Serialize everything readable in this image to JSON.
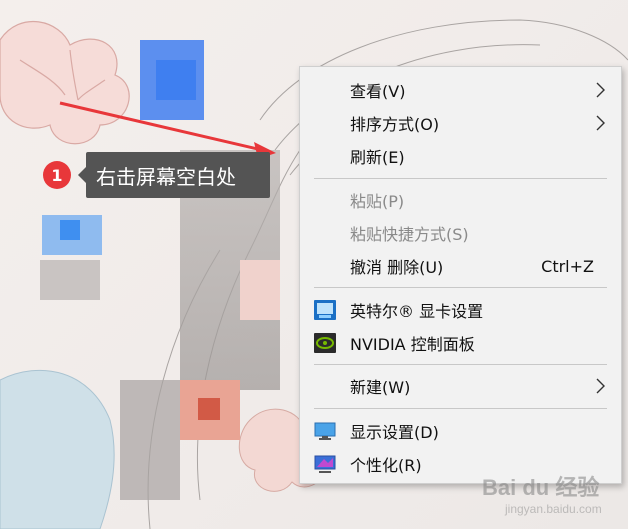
{
  "annotation": {
    "step_number": "1",
    "text": "右击屏幕空白处"
  },
  "context_menu": {
    "items": [
      {
        "label": "查看(V)",
        "has_submenu": true,
        "enabled": true
      },
      {
        "label": "排序方式(O)",
        "has_submenu": true,
        "enabled": true
      },
      {
        "label": "刷新(E)",
        "has_submenu": false,
        "enabled": true
      },
      {
        "label": "粘贴(P)",
        "has_submenu": false,
        "enabled": false
      },
      {
        "label": "粘贴快捷方式(S)",
        "has_submenu": false,
        "enabled": false
      },
      {
        "label": "撤消 删除(U)",
        "shortcut": "Ctrl+Z",
        "has_submenu": false,
        "enabled": true
      },
      {
        "label": "英特尔® 显卡设置",
        "icon": "intel-graphics-icon",
        "enabled": true
      },
      {
        "label": "NVIDIA 控制面板",
        "icon": "nvidia-icon",
        "enabled": true
      },
      {
        "label": "新建(W)",
        "has_submenu": true,
        "enabled": true
      },
      {
        "label": "显示设置(D)",
        "icon": "display-settings-icon",
        "enabled": true
      },
      {
        "label": "个性化(R)",
        "icon": "personalize-icon",
        "enabled": true
      }
    ]
  },
  "watermark": {
    "text": "Bai du 经验",
    "sub": "jingyan.baidu.com"
  },
  "colors": {
    "callout_bg": "#545454",
    "badge": "#e8373a",
    "arrow": "#e8373a",
    "menu_bg": "#f2f2f2"
  }
}
